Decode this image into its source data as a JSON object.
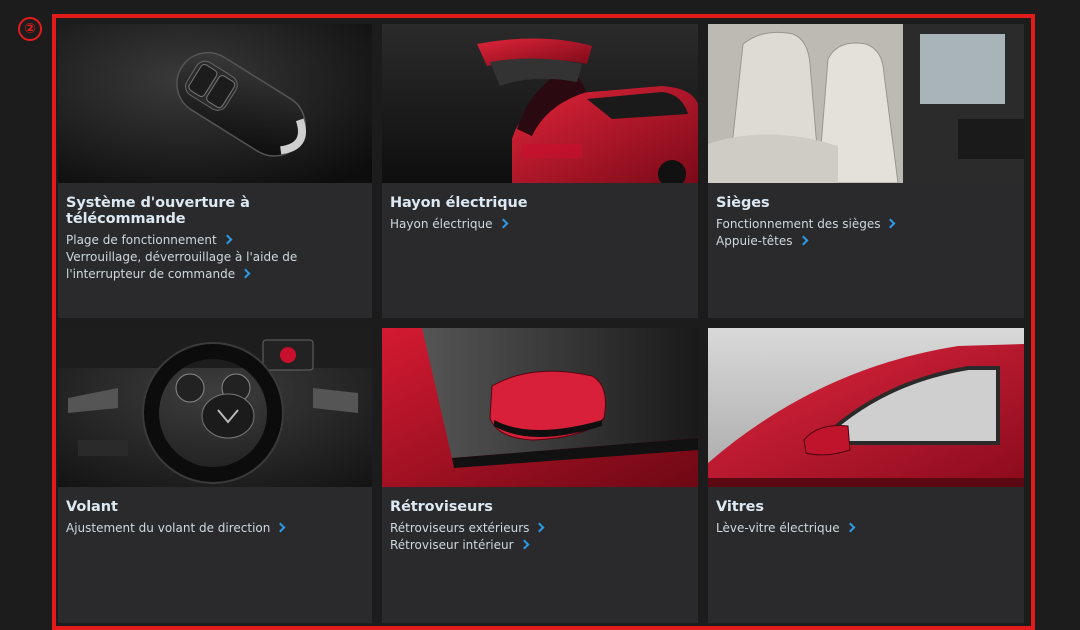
{
  "badge": "②",
  "cards": [
    {
      "title": "Système d'ouverture à télécommande",
      "links": [
        "Plage de fonctionnement",
        "Verrouillage, déverrouillage à l'aide de l'interrupteur de commande"
      ]
    },
    {
      "title": "Hayon électrique",
      "links": [
        "Hayon électrique"
      ]
    },
    {
      "title": "Sièges",
      "links": [
        "Fonctionnement des sièges",
        "Appuie-têtes"
      ]
    },
    {
      "title": "Volant",
      "links": [
        "Ajustement du volant de direction"
      ]
    },
    {
      "title": "Rétroviseurs",
      "links": [
        "Rétroviseurs extérieurs",
        "Rétroviseur intérieur"
      ]
    },
    {
      "title": "Vitres",
      "links": [
        "Lève-vitre électrique"
      ]
    }
  ],
  "colors": {
    "highlight": "#e31b1b",
    "chevron": "#2d9ae6",
    "card": "#2a2a2c",
    "car_red": "#c8102e"
  }
}
